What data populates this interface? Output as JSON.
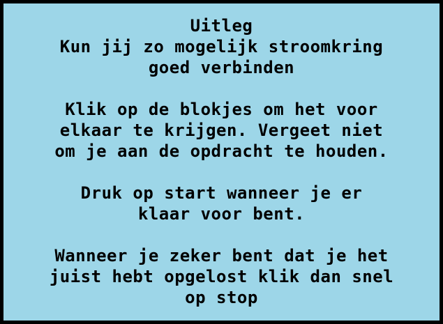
{
  "explanation_panel": {
    "title": "Uitleg",
    "intro_lines": [
      "Kun jij zo mogelijk stroomkring",
      "goed verbinden"
    ],
    "instruction_lines": [
      "Klik op de blokjes om het voor",
      "elkaar te krijgen. Vergeet niet",
      "om je aan de opdracht te houden."
    ],
    "start_lines": [
      "Druk op start wanneer je er",
      "klaar voor bent."
    ],
    "stop_lines": [
      "Wanneer je zeker bent dat je het",
      "juist hebt opgelost klik dan snel",
      "op stop"
    ]
  },
  "colors": {
    "background": "#9dd6e8",
    "border": "#000000",
    "text": "#000000"
  }
}
